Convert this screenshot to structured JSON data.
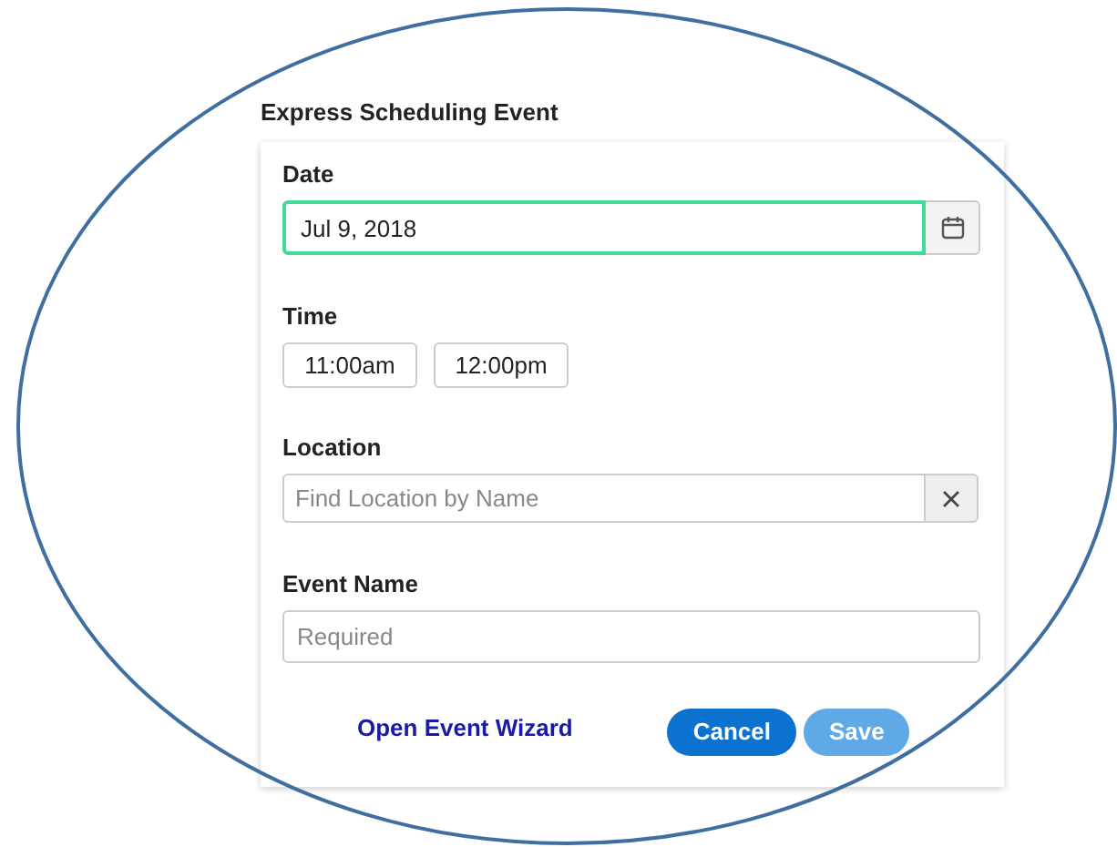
{
  "title": "Express Scheduling Event",
  "date": {
    "label": "Date",
    "value": "Jul 9, 2018",
    "focused": true
  },
  "time": {
    "label": "Time",
    "start": "11:00am",
    "end": "12:00pm"
  },
  "location": {
    "label": "Location",
    "placeholder": "Find Location by Name"
  },
  "event_name": {
    "label": "Event Name",
    "placeholder": "Required"
  },
  "wizard_link": "Open Event Wizard",
  "buttons": [
    {
      "label": "Cancel",
      "disabled": false
    },
    {
      "label": "Save",
      "disabled": true
    }
  ]
}
